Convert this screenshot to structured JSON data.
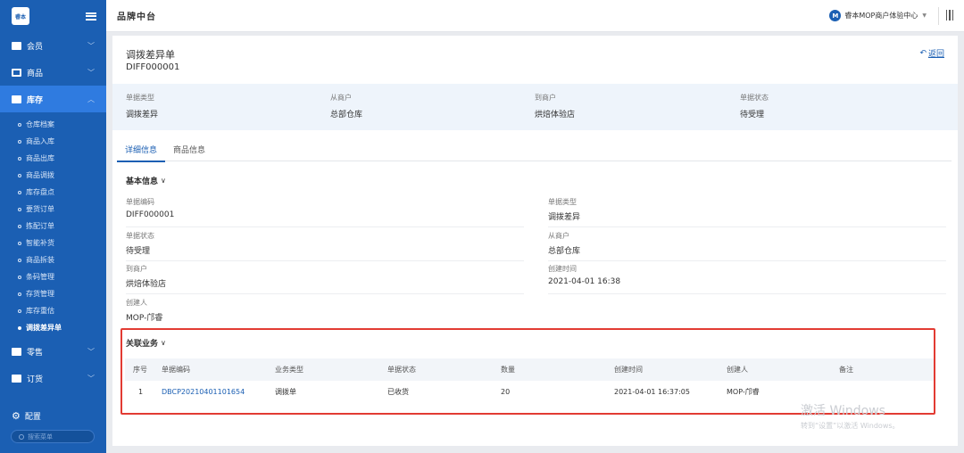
{
  "sidebar": {
    "logo_text": "睿本",
    "groups_top": [
      {
        "label": "会员",
        "icon": "member-card-icon"
      },
      {
        "label": "商品",
        "icon": "grid-icon"
      },
      {
        "label": "库存",
        "icon": "warehouse-icon"
      }
    ],
    "inventory_items": [
      "仓库档案",
      "商品入库",
      "商品出库",
      "商品调拨",
      "库存盘点",
      "要货订单",
      "拣配订单",
      "智能补货",
      "商品拆装",
      "条码管理",
      "存货管理",
      "库存重估",
      "调拨差异单"
    ],
    "groups_bottom": [
      {
        "label": "零售",
        "icon": "retail-icon"
      },
      {
        "label": "订货",
        "icon": "order-icon"
      }
    ],
    "config_label": "配置",
    "search_placeholder": "搜索菜单"
  },
  "topbar": {
    "brand": "品牌中台",
    "merchant_badge": "M",
    "merchant_name": "睿本MOP商户体验中心"
  },
  "page": {
    "title": "调拨差异单",
    "code": "DIFF000001",
    "back_label": "返回"
  },
  "summary": [
    {
      "label": "单据类型",
      "value": "调拨差异"
    },
    {
      "label": "从商户",
      "value": "总部仓库"
    },
    {
      "label": "到商户",
      "value": "烘焙体验店"
    },
    {
      "label": "单据状态",
      "value": "待受理"
    }
  ],
  "tabs": [
    "详细信息",
    "商品信息"
  ],
  "basic_info": {
    "title": "基本信息",
    "fields": [
      {
        "label": "单据编码",
        "value": "DIFF000001"
      },
      {
        "label": "单据类型",
        "value": "调拨差异"
      },
      {
        "label": "单据状态",
        "value": "待受理"
      },
      {
        "label": "从商户",
        "value": "总部仓库"
      },
      {
        "label": "到商户",
        "value": "烘焙体验店"
      },
      {
        "label": "创建时间",
        "value": "2021-04-01 16:38"
      },
      {
        "label": "创建人",
        "value": "MOP-邝睿"
      }
    ]
  },
  "related": {
    "title": "关联业务",
    "columns": [
      "序号",
      "单据编码",
      "业务类型",
      "单据状态",
      "数量",
      "创建时间",
      "创建人",
      "备注"
    ],
    "rows": [
      [
        "1",
        "DBCP20210401101654",
        "调拨单",
        "已收货",
        "20",
        "2021-04-01 16:37:05",
        "MOP-邝睿",
        ""
      ]
    ]
  },
  "watermark": {
    "line1": "激活 Windows",
    "line2": "转到“设置”以激活 Windows。"
  },
  "colors": {
    "sidebar": "#1b5fb3",
    "active": "#2f7be0",
    "highlight_border": "#e23b33"
  }
}
